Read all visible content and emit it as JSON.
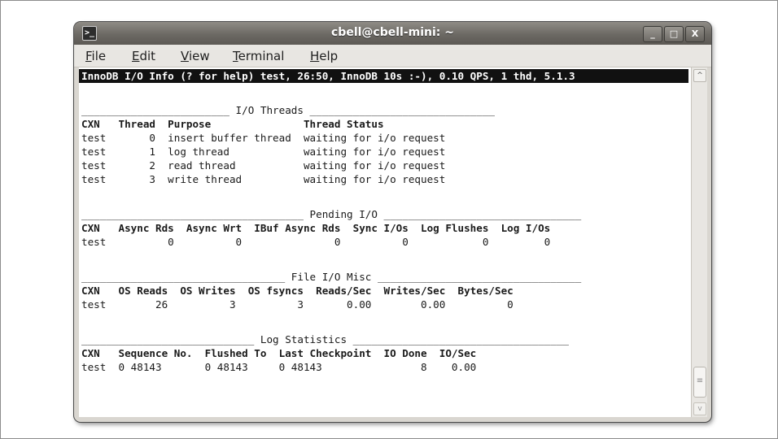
{
  "window": {
    "title": "cbell@cbell-mini: ~",
    "app_icon": "terminal-icon",
    "buttons": {
      "minimize": "_",
      "maximize": "□",
      "close": "X"
    }
  },
  "menubar": {
    "items": [
      {
        "label": "File",
        "mnemonic": "F",
        "rest": "ile"
      },
      {
        "label": "Edit",
        "mnemonic": "E",
        "rest": "dit"
      },
      {
        "label": "View",
        "mnemonic": "V",
        "rest": "iew"
      },
      {
        "label": "Terminal",
        "mnemonic": "T",
        "rest": "erminal"
      },
      {
        "label": "Help",
        "mnemonic": "H",
        "rest": "elp"
      }
    ]
  },
  "terminal": {
    "status_line": "InnoDB I/O Info (? for help) test, 26:50, InnoDB 10s :-), 0.10 QPS, 1 thd, 5.1.3",
    "io_threads": {
      "title": "________________________ I/O Threads ______________________________",
      "header": "CXN   Thread  Purpose               Thread Status",
      "rows": [
        "test       0  insert buffer thread  waiting for i/o request",
        "test       1  log thread            waiting for i/o request",
        "test       2  read thread           waiting for i/o request",
        "test       3  write thread          waiting for i/o request"
      ]
    },
    "pending_io": {
      "title": "____________________________________ Pending I/O ________________________________",
      "header": "CXN   Async Rds  Async Wrt  IBuf Async Rds  Sync I/Os  Log Flushes  Log I/Os",
      "rows": [
        "test          0          0               0          0            0         0"
      ]
    },
    "file_io_misc": {
      "title": "_________________________________ File I/O Misc _________________________________",
      "header": "CXN   OS Reads  OS Writes  OS fsyncs  Reads/Sec  Writes/Sec  Bytes/Sec",
      "rows": [
        "test        26          3          3       0.00        0.00          0"
      ]
    },
    "log_statistics": {
      "title": "____________________________ Log Statistics ___________________________________",
      "header": "CXN   Sequence No.  Flushed To  Last Checkpoint  IO Done  IO/Sec",
      "rows": [
        "test  0 48143       0 48143     0 48143                8    0.00"
      ]
    }
  },
  "scrollbar": {
    "up_icon": "^",
    "grip_icon": "≡",
    "down_icon": "v"
  }
}
